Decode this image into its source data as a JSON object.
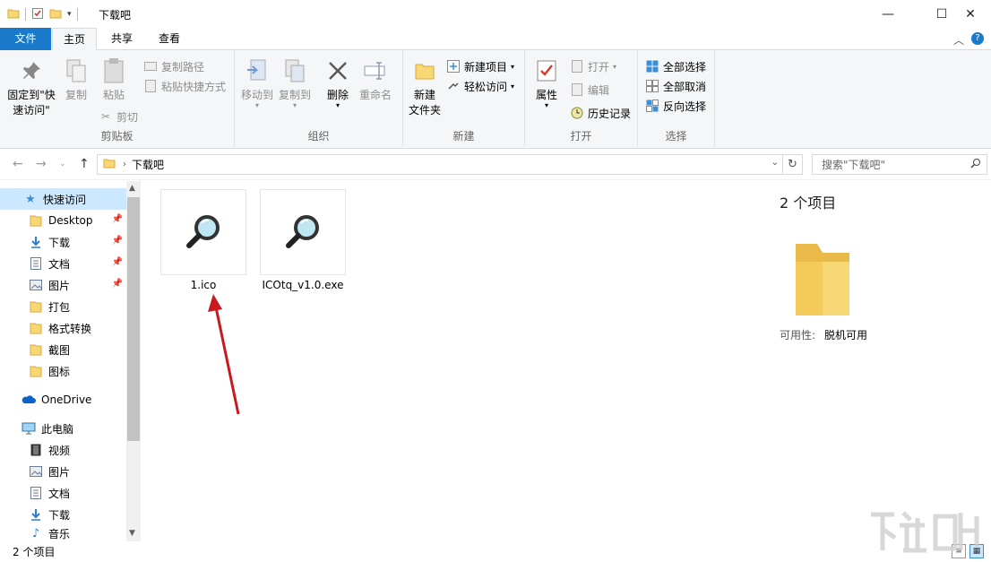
{
  "window": {
    "title": "下载吧",
    "minimize": "—",
    "maximize": "☐",
    "close": "✕"
  },
  "ribbon_tabs": [
    {
      "label": "文件"
    },
    {
      "label": "主页"
    },
    {
      "label": "共享"
    },
    {
      "label": "查看"
    }
  ],
  "ribbon": {
    "clipboard": {
      "pin_quick_access": "固定到\"快\n速访问\"",
      "copy": "复制",
      "paste": "粘贴",
      "copy_path": "复制路径",
      "paste_shortcut": "粘贴快捷方式",
      "cut": "剪切",
      "group": "剪贴板"
    },
    "organize": {
      "move_to": "移动到",
      "copy_to": "复制到",
      "delete": "删除",
      "rename": "重命名",
      "group": "组织"
    },
    "new": {
      "new_folder": "新建\n文件夹",
      "new_item": "新建项目",
      "easy_access": "轻松访问",
      "group": "新建"
    },
    "open": {
      "properties": "属性",
      "open": "打开",
      "edit": "编辑",
      "history": "历史记录",
      "group": "打开"
    },
    "select": {
      "select_all": "全部选择",
      "select_none": "全部取消",
      "invert": "反向选择",
      "group": "选择"
    }
  },
  "address": {
    "path": "下载吧",
    "search_placeholder": "搜索\"下载吧\""
  },
  "nav_pane": {
    "quick_access": "快速访问",
    "items": [
      {
        "label": "Desktop",
        "pinned": true
      },
      {
        "label": "下载",
        "pinned": true
      },
      {
        "label": "文档",
        "pinned": true
      },
      {
        "label": "图片",
        "pinned": true
      },
      {
        "label": "打包",
        "pinned": false
      },
      {
        "label": "格式转换",
        "pinned": false
      },
      {
        "label": "截图",
        "pinned": false
      },
      {
        "label": "图标",
        "pinned": false
      }
    ],
    "onedrive": "OneDrive",
    "this_pc": "此电脑",
    "pc_items": [
      {
        "label": "视频"
      },
      {
        "label": "图片"
      },
      {
        "label": "文档"
      },
      {
        "label": "下载"
      },
      {
        "label": "音乐"
      }
    ]
  },
  "files": [
    {
      "name": "1.ico"
    },
    {
      "name": "ICOtq_v1.0.exe"
    }
  ],
  "preview": {
    "count": "2 个项目",
    "availability_label": "可用性:",
    "availability_value": "脱机可用"
  },
  "status": {
    "text": "2 个项目"
  },
  "colors": {
    "file_tab": "#1979ca",
    "selection": "#cce8ff",
    "folder": "#f8d775",
    "annotation_arrow": "#c8191e"
  }
}
